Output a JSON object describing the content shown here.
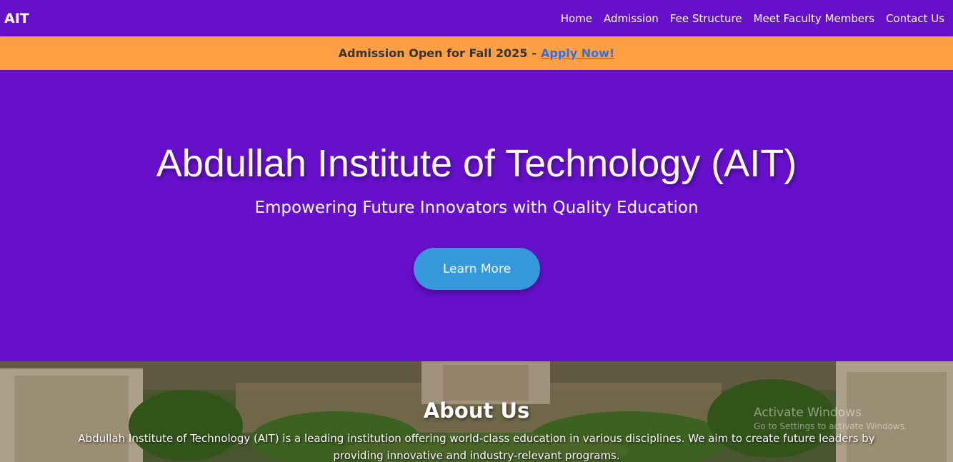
{
  "nav": {
    "brand": "AIT",
    "links": [
      "Home",
      "Admission",
      "Fee Structure",
      "Meet Faculty Members",
      "Contact Us"
    ]
  },
  "banner": {
    "text": "Admission Open for Fall 2025",
    "separator": "-",
    "link": "Apply Now!"
  },
  "hero": {
    "title": "Abdullah Institute of Technology (AIT)",
    "subtitle": "Empowering Future Innovators with Quality Education",
    "button": "Learn More"
  },
  "about": {
    "heading": "About Us",
    "text": "Abdullah Institute of Technology (AIT) is a leading institution offering world-class education in various disciplines. We aim to create future leaders by providing innovative and industry-relevant programs."
  },
  "watermark": {
    "line1": "Activate Windows",
    "line2": "Go to Settings to activate Windows."
  },
  "colors": {
    "primary": "#6610cc",
    "banner": "#ff9f43",
    "button": "#3498db",
    "link": "#2f6fe0"
  }
}
